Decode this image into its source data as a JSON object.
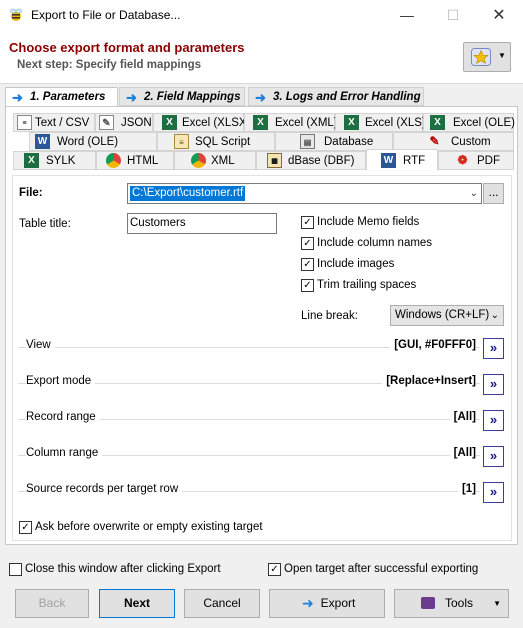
{
  "window": {
    "title": "Export to File or Database..."
  },
  "header": {
    "heading": "Choose export format and parameters",
    "next_step": "Next step: Specify field mappings"
  },
  "steps": [
    {
      "label": "1. Parameters"
    },
    {
      "label": "2. Field Mappings"
    },
    {
      "label": "3. Logs and Error Handling"
    }
  ],
  "format_tabs": {
    "row1": [
      "Text / CSV",
      "JSON",
      "Excel (XLSX)",
      "Excel (XML)",
      "Excel (XLS)",
      "Excel (OLE)"
    ],
    "row2": [
      "Word (OLE)",
      "SQL Script",
      "Database",
      "Custom"
    ],
    "row3": [
      "SYLK",
      "HTML",
      "XML",
      "dBase (DBF)",
      "RTF",
      "PDF"
    ]
  },
  "form": {
    "file_label": "File:",
    "file_value": "C:\\Export\\customer.rtf",
    "browse_label": "...",
    "table_title_label": "Table title:",
    "table_title_value": "Customers",
    "checkboxes": [
      {
        "label": "Include Memo fields",
        "checked": true
      },
      {
        "label": "Include column names",
        "checked": true
      },
      {
        "label": "Include images",
        "checked": true
      },
      {
        "label": "Trim trailing spaces",
        "checked": true
      }
    ],
    "line_break_label": "Line break:",
    "line_break_value": "Windows (CR+LF)",
    "groups": [
      {
        "label": "View",
        "value": "[GUI, #F0FFF0]"
      },
      {
        "label": "Export mode",
        "value": "[Replace+Insert]"
      },
      {
        "label": "Record range",
        "value": "[All]"
      },
      {
        "label": "Column range",
        "value": "[All]"
      },
      {
        "label": "Source records per target row",
        "value": "[1]"
      }
    ],
    "ask_overwrite": {
      "label": "Ask before overwrite or empty existing target",
      "checked": true
    }
  },
  "footer": {
    "close_after": {
      "label": "Close this window after clicking Export",
      "checked": false
    },
    "open_target": {
      "label": "Open target after successful exporting",
      "checked": true
    }
  },
  "buttons": {
    "back": "Back",
    "next": "Next",
    "cancel": "Cancel",
    "export": "Export",
    "tools": "Tools"
  },
  "colors": {
    "heading": "#8b0000",
    "accent_blue": "#0078d7",
    "step_arrow": "#1e7fd8"
  }
}
